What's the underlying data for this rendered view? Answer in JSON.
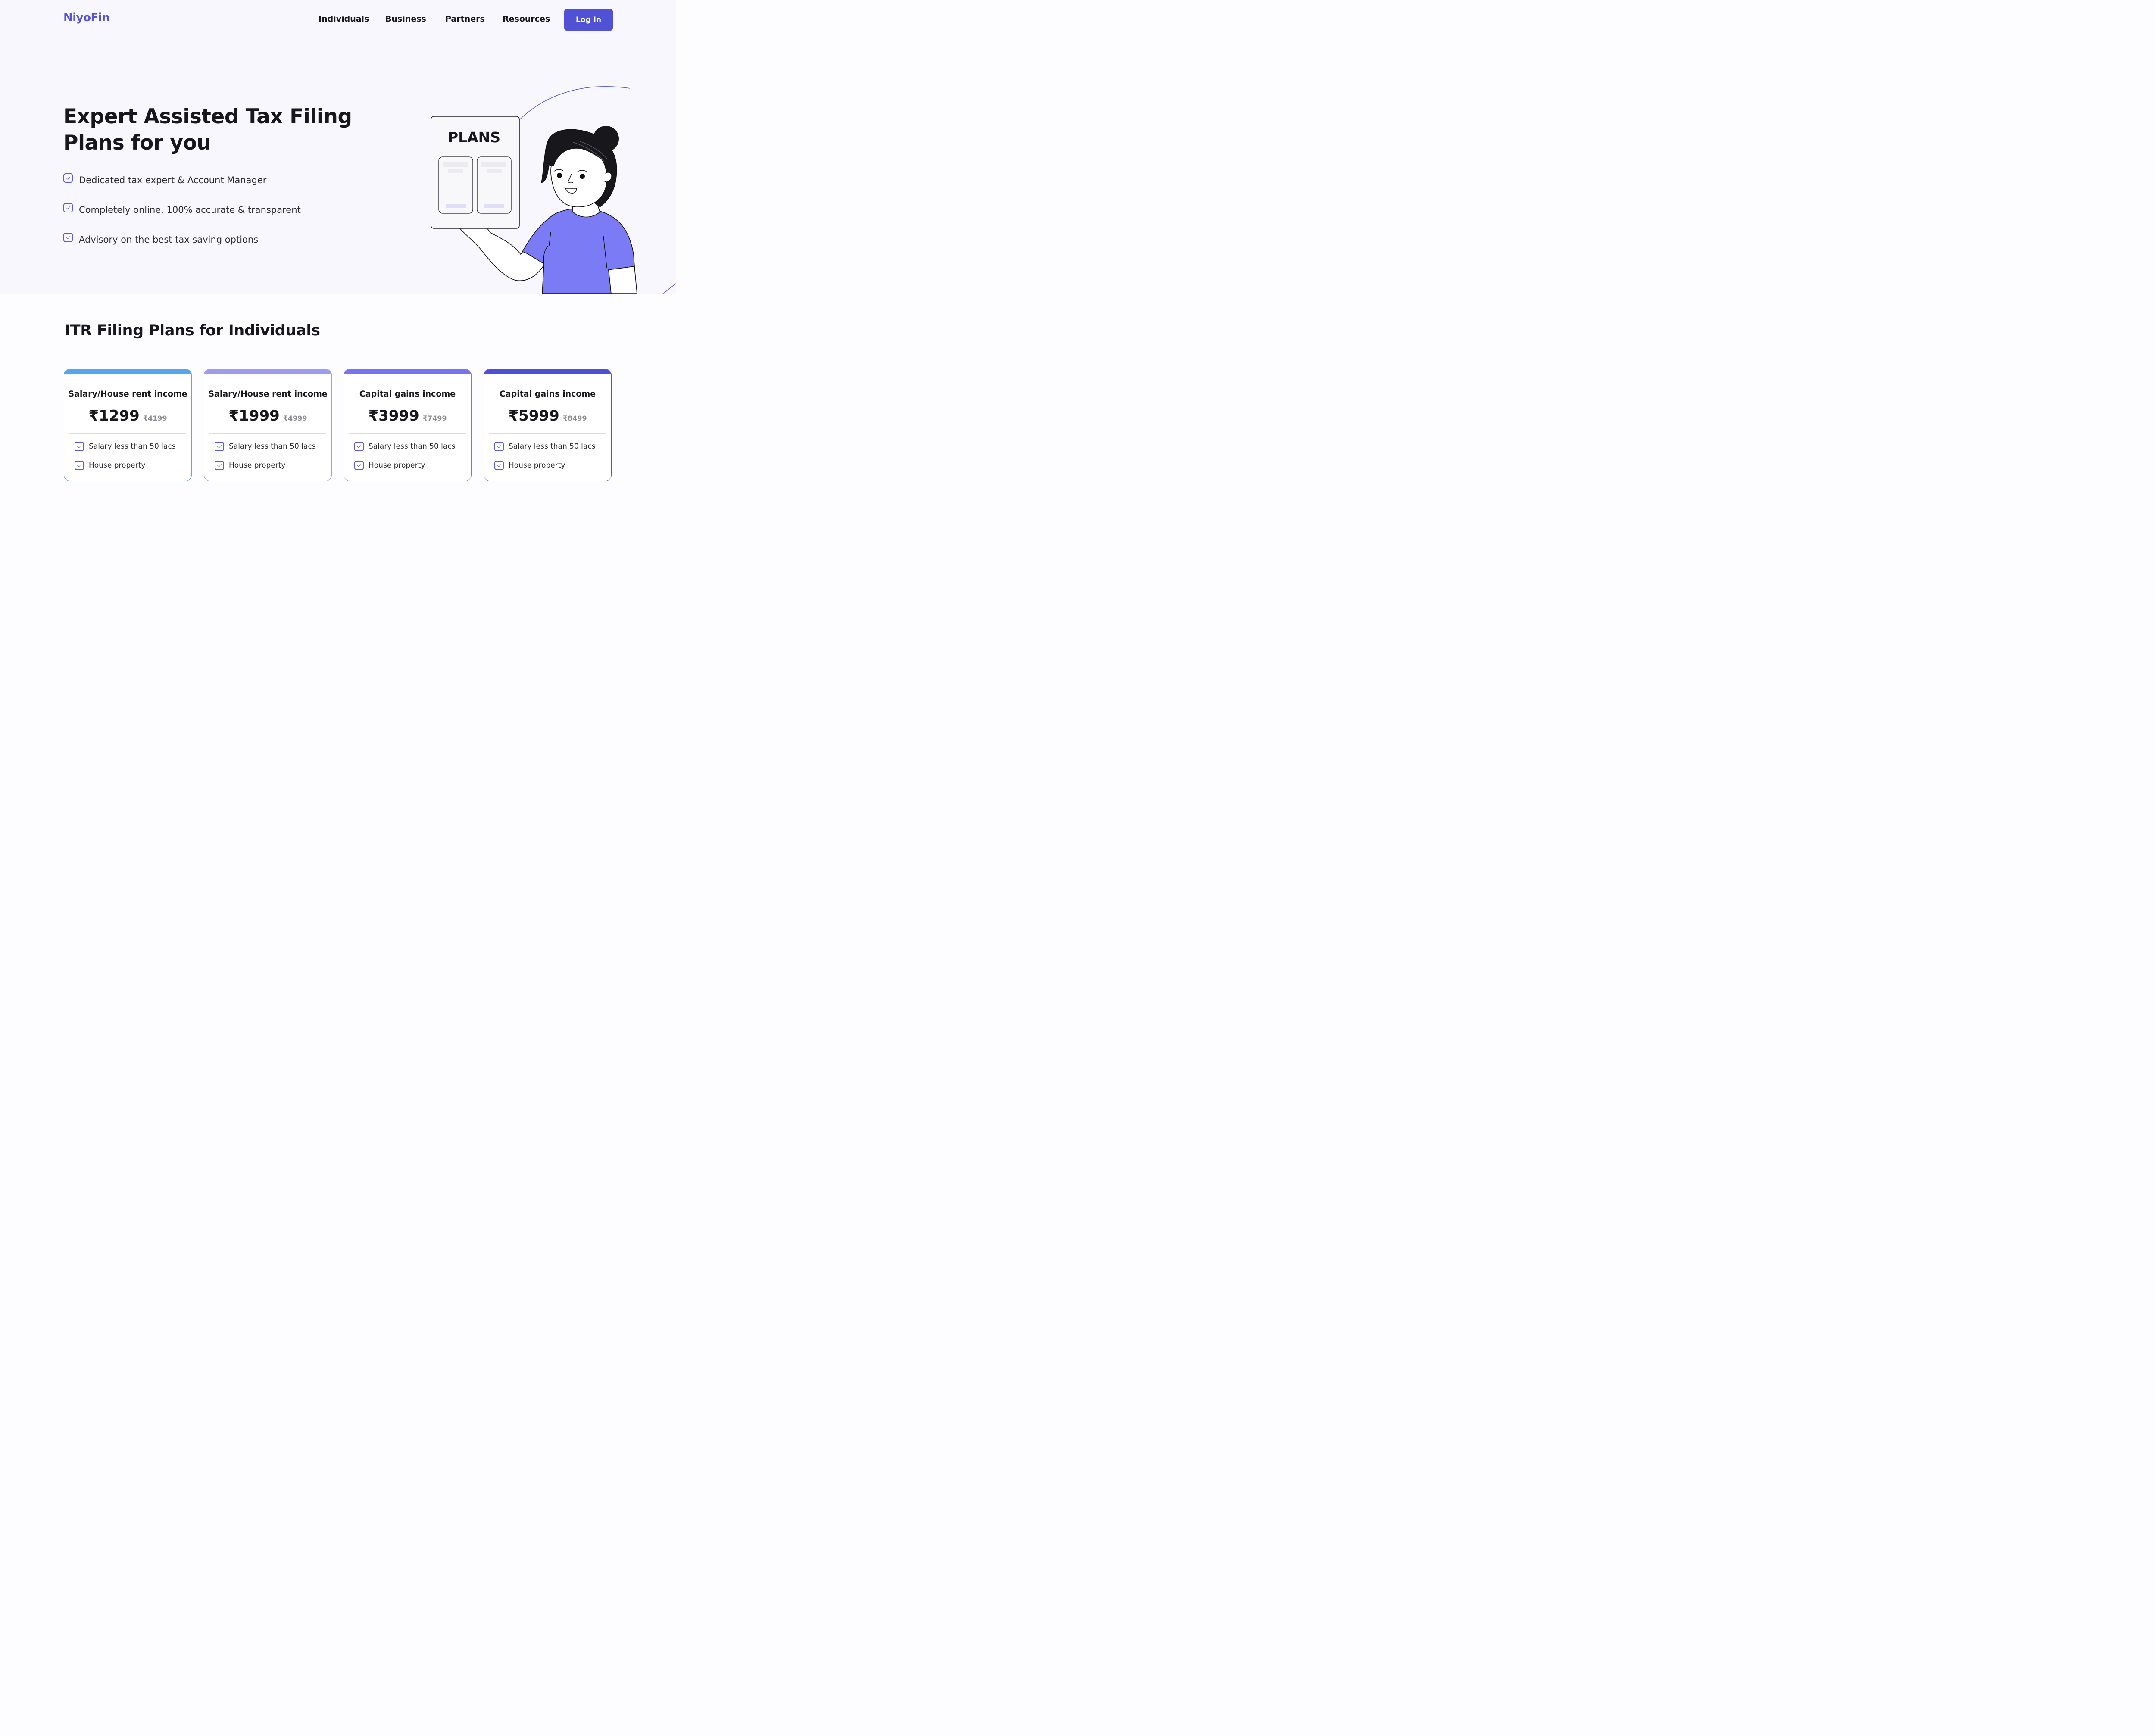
{
  "brand": {
    "name": "NiyoFin"
  },
  "nav": {
    "items": [
      "Individuals",
      "Business",
      "Partners",
      "Resources"
    ],
    "login_label": "Log In"
  },
  "hero": {
    "title_line1": "Expert Assisted Tax Filing",
    "title_line2": "Plans for you",
    "features": [
      "Dedicated tax expert & Account Manager",
      "Completely online, 100% accurate & transparent",
      "Advisory on the best tax saving options"
    ],
    "illustration": {
      "board_label": "PLANS"
    }
  },
  "plans_section": {
    "title": "ITR Filing Plans for Individuals",
    "plans": [
      {
        "title": "Salary/House rent income",
        "price": "₹1299",
        "old_price": "₹4199",
        "accent": "#55a6ec",
        "features": [
          "Salary less than 50 lacs",
          "House property"
        ]
      },
      {
        "title": "Salary/House rent income",
        "price": "₹1999",
        "old_price": "₹4999",
        "accent": "#9c9cf2",
        "features": [
          "Salary less than 50 lacs",
          "House property"
        ]
      },
      {
        "title": "Capital gains income",
        "price": "₹3999",
        "old_price": "₹7499",
        "accent": "#7474ef",
        "features": [
          "Salary less than 50 lacs",
          "House property"
        ]
      },
      {
        "title": "Capital gains income",
        "price": "₹5999",
        "old_price": "₹8499",
        "accent": "#4f4fd4",
        "features": [
          "Salary less than 50 lacs",
          "House property"
        ]
      }
    ]
  },
  "colors": {
    "brand": "#5454d8",
    "hero_bg": "#f8f7fd",
    "shirt": "#7b7bf6"
  },
  "icons": {
    "check": "checkbox-check-icon"
  }
}
